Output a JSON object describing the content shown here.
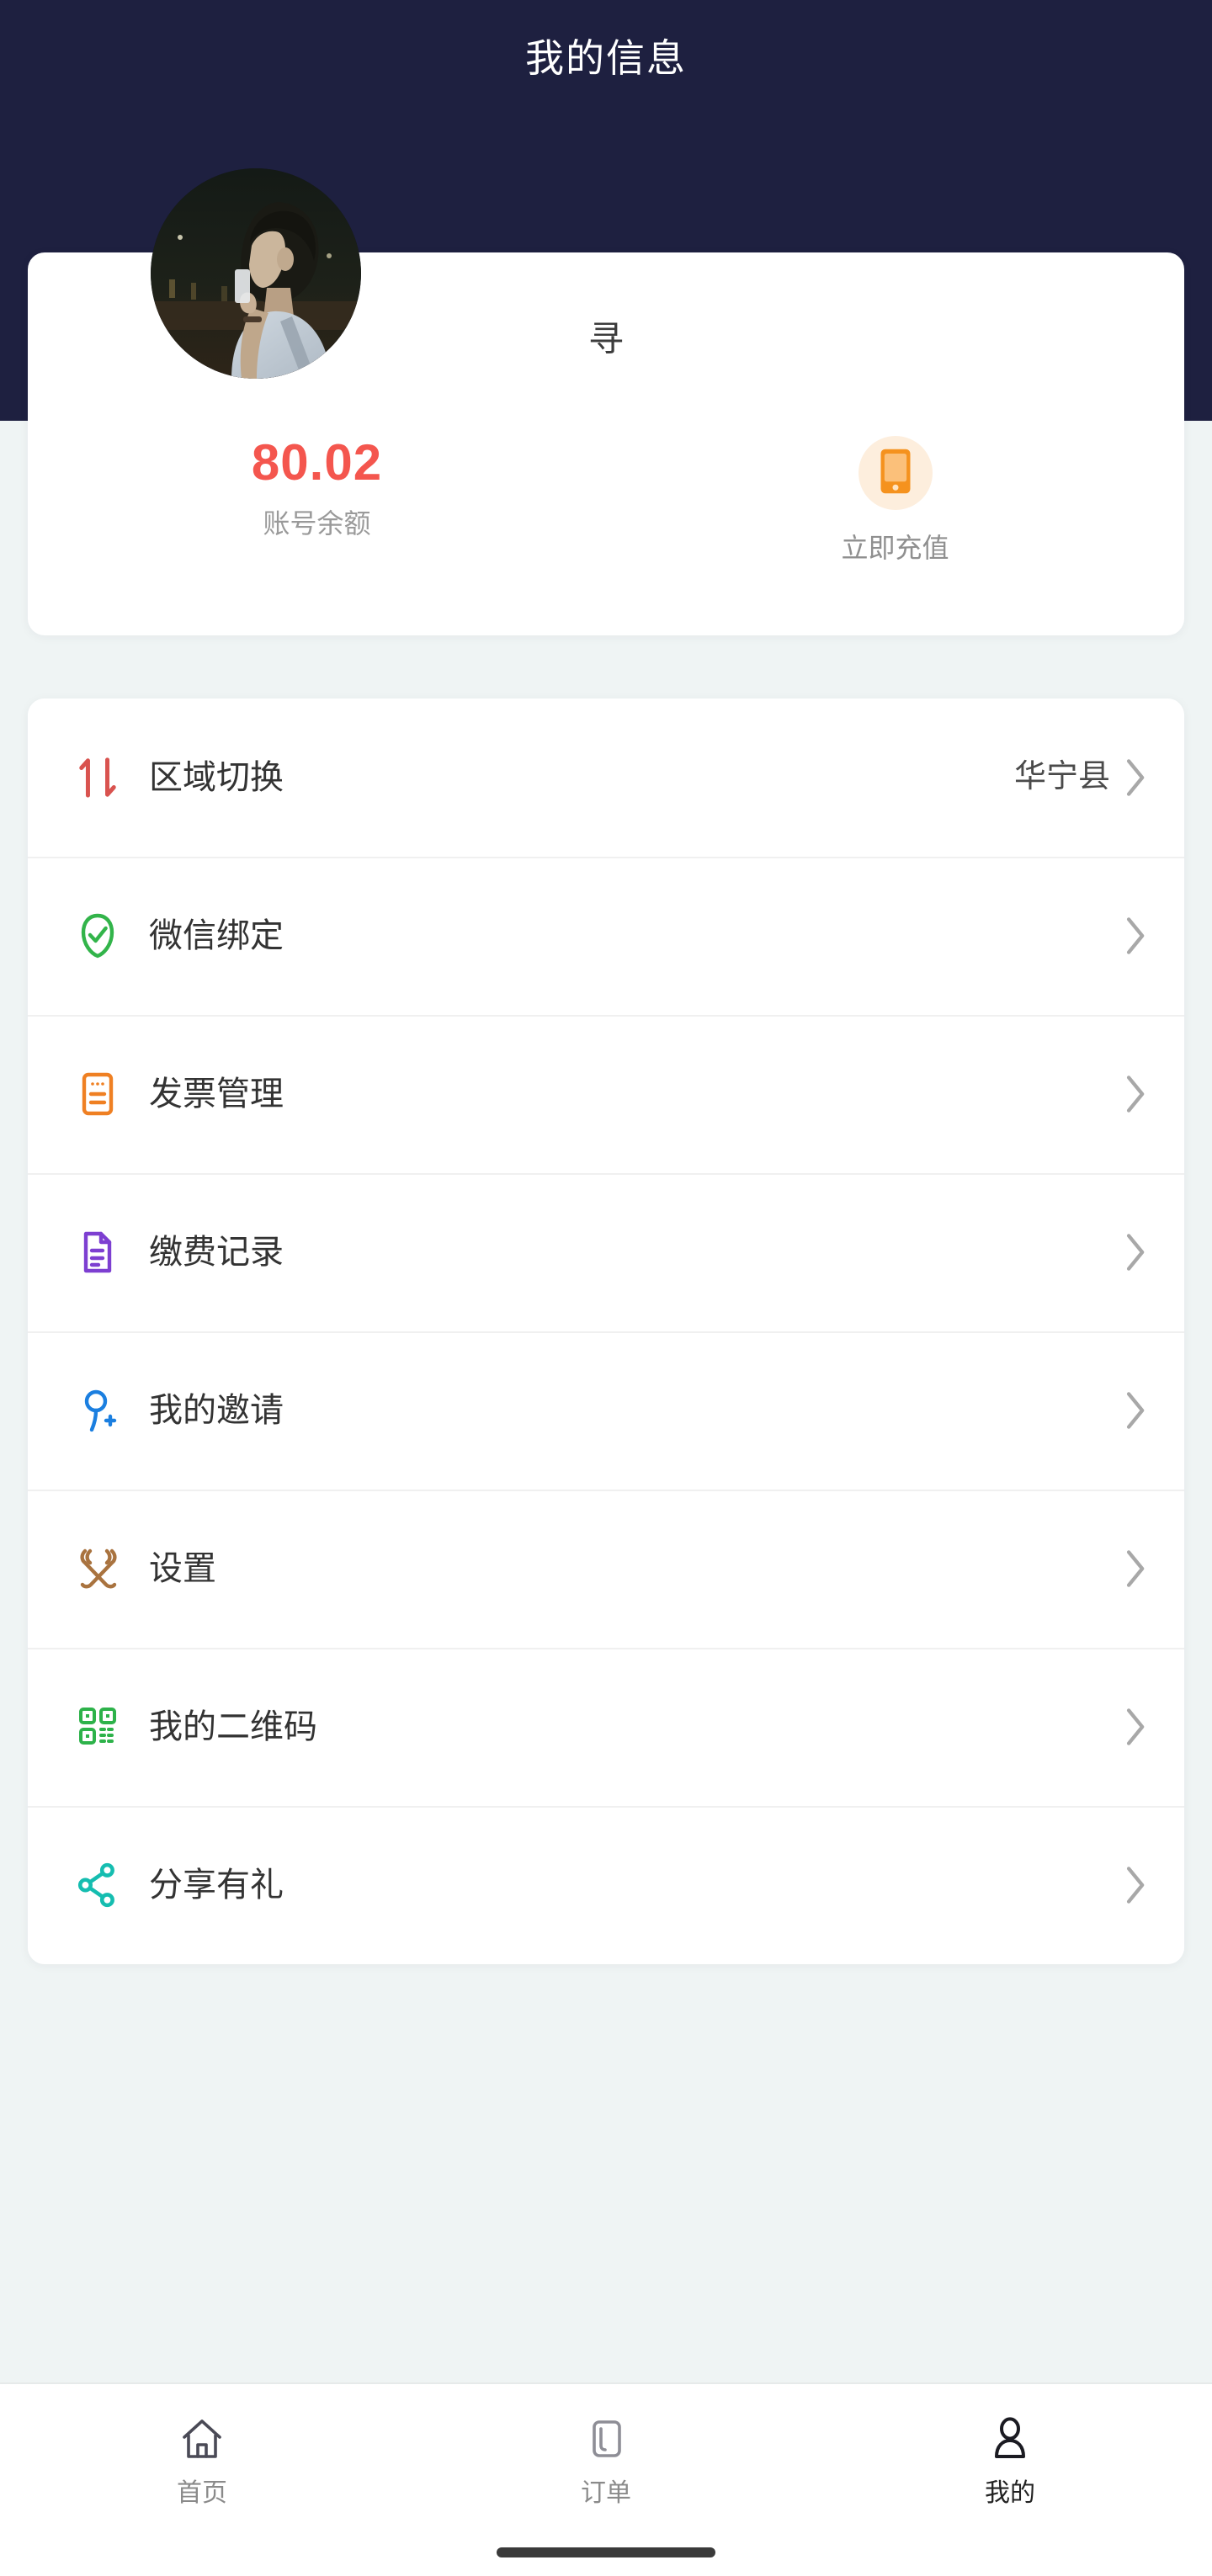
{
  "theme": {
    "header_bg": "#1e2040",
    "page_bg": "#eff4f4",
    "card_bg": "#ffffff",
    "accent_red": "#f4564e",
    "accent_orange": "#f5921e",
    "muted_text": "#9a9a9a",
    "primary_text": "#333333",
    "chevron": "#c4c4c4"
  },
  "header": {
    "title": "我的信息"
  },
  "profile": {
    "avatar_alt": "avatar-photo",
    "username": "寻",
    "balance": {
      "amount": "80.02",
      "label": "账号余额"
    },
    "recharge": {
      "label": "立即充值",
      "icon": "mobile-phone-icon"
    }
  },
  "menu": {
    "items": [
      {
        "id": "region-switch",
        "label": "区域切换",
        "value": "华宁县",
        "icon": "arrows-up-down-icon",
        "color": "#d9534f"
      },
      {
        "id": "wechat-bind",
        "label": "微信绑定",
        "value": "",
        "icon": "shield-check-icon",
        "color": "#32b44a"
      },
      {
        "id": "invoice-manage",
        "label": "发票管理",
        "value": "",
        "icon": "invoice-icon",
        "color": "#ef8023"
      },
      {
        "id": "payment-record",
        "label": "缴费记录",
        "value": "",
        "icon": "document-icon",
        "color": "#7d3fd1"
      },
      {
        "id": "my-invite",
        "label": "我的邀请",
        "value": "",
        "icon": "user-plus-icon",
        "color": "#1b7fe0"
      },
      {
        "id": "settings",
        "label": "设置",
        "value": "",
        "icon": "tools-icon",
        "color": "#a9733f"
      },
      {
        "id": "my-qrcode",
        "label": "我的二维码",
        "value": "",
        "icon": "qr-code-icon",
        "color": "#2db24a"
      },
      {
        "id": "share-gift",
        "label": "分享有礼",
        "value": "",
        "icon": "share-nodes-icon",
        "color": "#15bdb0"
      }
    ]
  },
  "tabbar": {
    "tabs": [
      {
        "id": "home",
        "label": "首页",
        "icon": "home-icon",
        "active": false
      },
      {
        "id": "orders",
        "label": "订单",
        "icon": "document-tab-icon",
        "active": false
      },
      {
        "id": "mine",
        "label": "我的",
        "icon": "person-icon",
        "active": true
      }
    ]
  }
}
